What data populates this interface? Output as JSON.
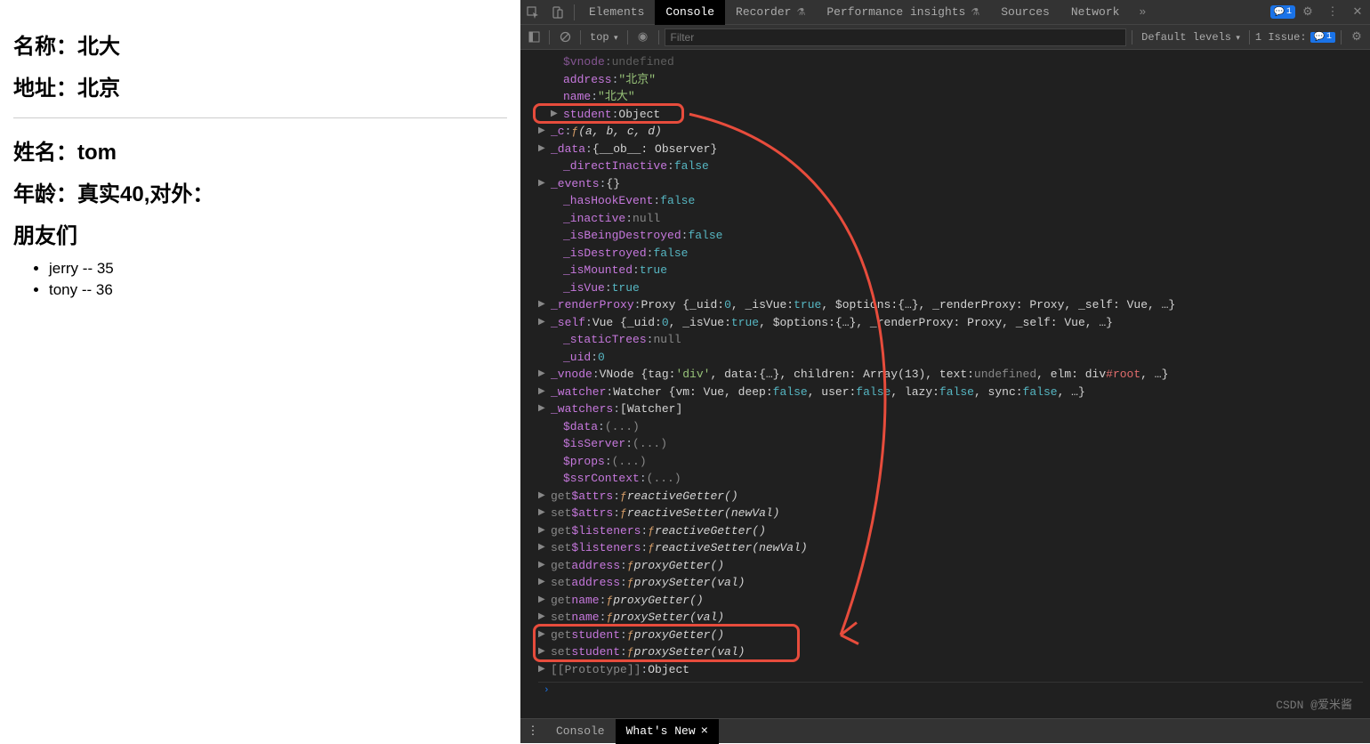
{
  "page": {
    "name_label": "名称：",
    "name_value": "北大",
    "address_label": "地址：",
    "address_value": "北京",
    "student_name_label": "姓名：",
    "student_name_value": "tom",
    "age_label": "年龄：",
    "age_value": "真实40,对外：",
    "friends_label": "朋友们",
    "friends": [
      {
        "text": "jerry -- 35"
      },
      {
        "text": "tony -- 36"
      }
    ]
  },
  "devtools": {
    "tabs": {
      "elements": "Elements",
      "console": "Console",
      "recorder": "Recorder",
      "performance": "Performance insights",
      "sources": "Sources",
      "network": "Network"
    },
    "badge_count": "1",
    "toolbar": {
      "context": "top",
      "filter_placeholder": "Filter",
      "levels": "Default levels",
      "issue_label": "1 Issue:",
      "issue_count": "1"
    },
    "bottom": {
      "console": "Console",
      "whatsnew": "What's New"
    }
  },
  "console": {
    "lines": [
      {
        "indent": 14,
        "tri": "none",
        "key": "$vnode",
        "sep": ":",
        "rest": [
          [
            "gray",
            "undefined"
          ]
        ],
        "dim": true
      },
      {
        "indent": 14,
        "tri": "none",
        "key": "address",
        "sep": ":",
        "rest": [
          [
            "str",
            "\"北京\""
          ]
        ]
      },
      {
        "indent": 14,
        "tri": "none",
        "key": "name",
        "sep": ":",
        "rest": [
          [
            "str",
            "\"北大\""
          ]
        ]
      },
      {
        "indent": 14,
        "tri": "▶",
        "key": "student",
        "sep": ":",
        "rest": [
          [
            "white",
            "Object"
          ]
        ],
        "hl": "top"
      },
      {
        "indent": 0,
        "tri": "▶",
        "key": "_c",
        "sep": ":",
        "rest": [
          [
            "orange",
            "ƒ "
          ],
          [
            "italic",
            "(a, b, c, d)"
          ]
        ]
      },
      {
        "indent": 0,
        "tri": "▶",
        "key": "_data",
        "sep": ":",
        "rest": [
          [
            "white",
            "{__ob__: Observer}"
          ]
        ]
      },
      {
        "indent": 14,
        "tri": "none",
        "key": "_directInactive",
        "sep": ":",
        "rest": [
          [
            "blue",
            "false"
          ]
        ]
      },
      {
        "indent": 0,
        "tri": "▶",
        "key": "_events",
        "sep": ":",
        "rest": [
          [
            "white",
            "{}"
          ]
        ]
      },
      {
        "indent": 14,
        "tri": "none",
        "key": "_hasHookEvent",
        "sep": ":",
        "rest": [
          [
            "blue",
            "false"
          ]
        ]
      },
      {
        "indent": 14,
        "tri": "none",
        "key": "_inactive",
        "sep": ":",
        "rest": [
          [
            "gray",
            "null"
          ]
        ]
      },
      {
        "indent": 14,
        "tri": "none",
        "key": "_isBeingDestroyed",
        "sep": ":",
        "rest": [
          [
            "blue",
            "false"
          ]
        ]
      },
      {
        "indent": 14,
        "tri": "none",
        "key": "_isDestroyed",
        "sep": ":",
        "rest": [
          [
            "blue",
            "false"
          ]
        ]
      },
      {
        "indent": 14,
        "tri": "none",
        "key": "_isMounted",
        "sep": ":",
        "rest": [
          [
            "blue",
            "true"
          ]
        ]
      },
      {
        "indent": 14,
        "tri": "none",
        "key": "_isVue",
        "sep": ":",
        "rest": [
          [
            "blue",
            "true"
          ]
        ]
      },
      {
        "indent": 0,
        "tri": "▶",
        "key": "_renderProxy",
        "sep": ":",
        "rest": [
          [
            "white",
            "Proxy {_uid: "
          ],
          [
            "blue",
            "0"
          ],
          [
            "white",
            ", _isVue: "
          ],
          [
            "blue",
            "true"
          ],
          [
            "white",
            ", $options: "
          ],
          [
            "white",
            "{…}"
          ],
          [
            "white",
            ", _renderProxy: Proxy, _self: Vue, …}"
          ]
        ]
      },
      {
        "indent": 0,
        "tri": "▶",
        "key": "_self",
        "sep": ":",
        "rest": [
          [
            "white",
            "Vue {_uid: "
          ],
          [
            "blue",
            "0"
          ],
          [
            "white",
            ", _isVue: "
          ],
          [
            "blue",
            "true"
          ],
          [
            "white",
            ", $options: "
          ],
          [
            "white",
            "{…}"
          ],
          [
            "white",
            ", _renderProxy: Proxy, _self: Vue, …}"
          ]
        ]
      },
      {
        "indent": 14,
        "tri": "none",
        "key": "_staticTrees",
        "sep": ":",
        "rest": [
          [
            "gray",
            "null"
          ]
        ]
      },
      {
        "indent": 14,
        "tri": "none",
        "key": "_uid",
        "sep": ":",
        "rest": [
          [
            "blue",
            "0"
          ]
        ]
      },
      {
        "indent": 0,
        "tri": "▶",
        "key": "_vnode",
        "sep": ":",
        "rest": [
          [
            "white",
            "VNode {tag: "
          ],
          [
            "str",
            "'div'"
          ],
          [
            "white",
            ", data: "
          ],
          [
            "white",
            "{…}"
          ],
          [
            "white",
            ", children: Array(13), text: "
          ],
          [
            "gray",
            "undefined"
          ],
          [
            "white",
            ", elm: div"
          ],
          [
            "red",
            "#root"
          ],
          [
            "white",
            ", …}"
          ]
        ]
      },
      {
        "indent": 0,
        "tri": "▶",
        "key": "_watcher",
        "sep": ":",
        "rest": [
          [
            "white",
            "Watcher {vm: Vue, deep: "
          ],
          [
            "blue",
            "false"
          ],
          [
            "white",
            ", user: "
          ],
          [
            "blue",
            "false"
          ],
          [
            "white",
            ", lazy: "
          ],
          [
            "blue",
            "false"
          ],
          [
            "white",
            ", sync: "
          ],
          [
            "blue",
            "false"
          ],
          [
            "white",
            ", …}"
          ]
        ]
      },
      {
        "indent": 0,
        "tri": "▶",
        "key": "_watchers",
        "sep": ":",
        "rest": [
          [
            "white",
            "[Watcher]"
          ]
        ]
      },
      {
        "indent": 14,
        "tri": "none",
        "key": "$data",
        "sep": ":",
        "rest": [
          [
            "gray",
            "(...)"
          ]
        ]
      },
      {
        "indent": 14,
        "tri": "none",
        "key": "$isServer",
        "sep": ":",
        "rest": [
          [
            "gray",
            "(...)"
          ]
        ]
      },
      {
        "indent": 14,
        "tri": "none",
        "key": "$props",
        "sep": ":",
        "rest": [
          [
            "gray",
            "(...)"
          ]
        ]
      },
      {
        "indent": 14,
        "tri": "none",
        "key": "$ssrContext",
        "sep": ":",
        "rest": [
          [
            "gray",
            "(...)"
          ]
        ]
      },
      {
        "indent": 0,
        "tri": "▶",
        "prefix": "get ",
        "key": "$attrs",
        "sep": ":",
        "rest": [
          [
            "orange",
            "ƒ "
          ],
          [
            "italic",
            "reactiveGetter()"
          ]
        ]
      },
      {
        "indent": 0,
        "tri": "▶",
        "prefix": "set ",
        "key": "$attrs",
        "sep": ":",
        "rest": [
          [
            "orange",
            "ƒ "
          ],
          [
            "italic",
            "reactiveSetter(newVal)"
          ]
        ]
      },
      {
        "indent": 0,
        "tri": "▶",
        "prefix": "get ",
        "key": "$listeners",
        "sep": ":",
        "rest": [
          [
            "orange",
            "ƒ "
          ],
          [
            "italic",
            "reactiveGetter()"
          ]
        ]
      },
      {
        "indent": 0,
        "tri": "▶",
        "prefix": "set ",
        "key": "$listeners",
        "sep": ":",
        "rest": [
          [
            "orange",
            "ƒ "
          ],
          [
            "italic",
            "reactiveSetter(newVal)"
          ]
        ]
      },
      {
        "indent": 0,
        "tri": "▶",
        "prefix": "get ",
        "key": "address",
        "sep": ":",
        "rest": [
          [
            "orange",
            "ƒ "
          ],
          [
            "italic",
            "proxyGetter()"
          ]
        ]
      },
      {
        "indent": 0,
        "tri": "▶",
        "prefix": "set ",
        "key": "address",
        "sep": ":",
        "rest": [
          [
            "orange",
            "ƒ "
          ],
          [
            "italic",
            "proxySetter(val)"
          ]
        ]
      },
      {
        "indent": 0,
        "tri": "▶",
        "prefix": "get ",
        "key": "name",
        "sep": ":",
        "rest": [
          [
            "orange",
            "ƒ "
          ],
          [
            "italic",
            "proxyGetter()"
          ]
        ]
      },
      {
        "indent": 0,
        "tri": "▶",
        "prefix": "set ",
        "key": "name",
        "sep": ":",
        "rest": [
          [
            "orange",
            "ƒ "
          ],
          [
            "italic",
            "proxySetter(val)"
          ]
        ]
      },
      {
        "indent": 0,
        "tri": "▶",
        "prefix": "get ",
        "key": "student",
        "sep": ":",
        "rest": [
          [
            "orange",
            "ƒ "
          ],
          [
            "italic",
            "proxyGetter()"
          ]
        ],
        "hl": "bot1"
      },
      {
        "indent": 0,
        "tri": "▶",
        "prefix": "set ",
        "key": "student",
        "sep": ":",
        "rest": [
          [
            "orange",
            "ƒ "
          ],
          [
            "italic",
            "proxySetter(val)"
          ]
        ],
        "hl": "bot2"
      },
      {
        "indent": 0,
        "tri": "▶",
        "key": "[[Prototype]]",
        "sep": ":",
        "rest": [
          [
            "white",
            "Object"
          ]
        ],
        "gray_key": true
      }
    ]
  },
  "watermark": "CSDN @爱米酱"
}
